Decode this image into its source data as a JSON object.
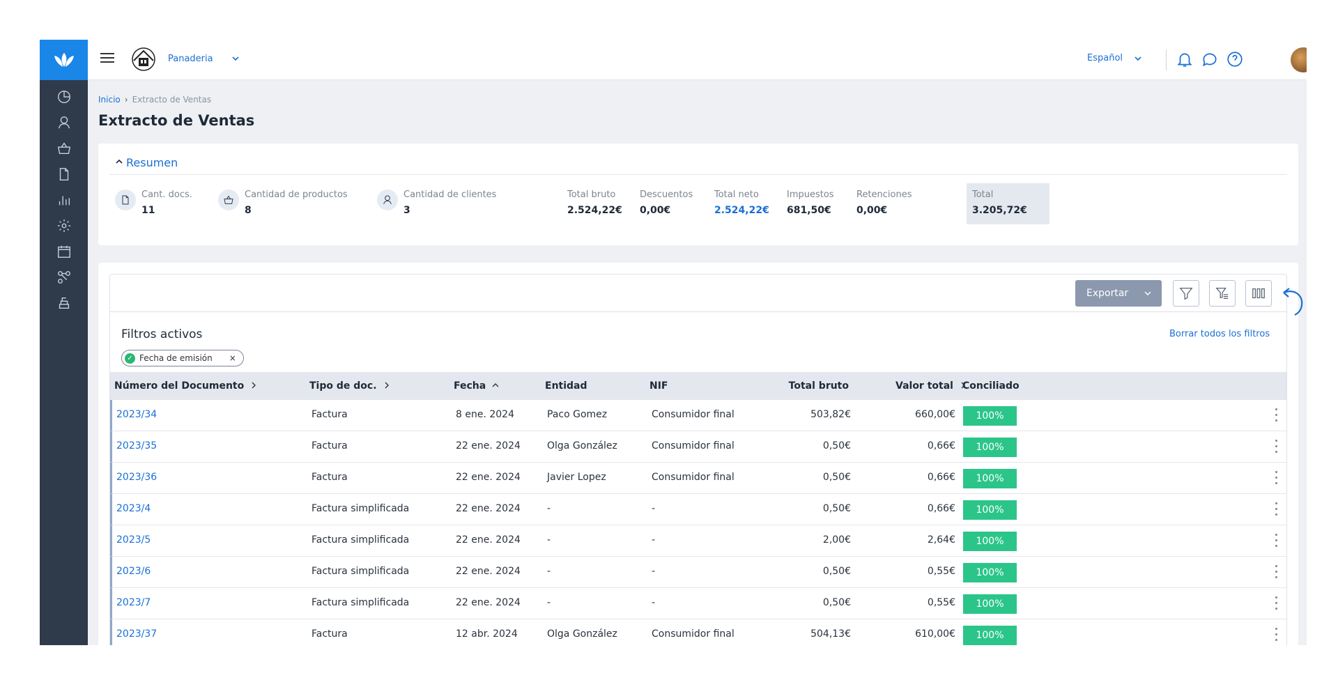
{
  "topbar": {
    "company_name": "Panaderia",
    "language": "Español"
  },
  "breadcrumb": {
    "home": "Inicio",
    "separator": "›",
    "current": "Extracto de Ventas"
  },
  "page": {
    "title": "Extracto de Ventas"
  },
  "summary": {
    "header": "Resumen",
    "stats": [
      {
        "label": "Cant. docs.",
        "value": "11",
        "icon": "document-icon"
      },
      {
        "label": "Cantidad de productos",
        "value": "8",
        "icon": "basket-icon"
      },
      {
        "label": "Cantidad de clientes",
        "value": "3",
        "icon": "user-icon"
      }
    ],
    "totals": [
      {
        "label": "Total bruto",
        "value": "2.524,22€"
      },
      {
        "label": "Descuentos",
        "value": "0,00€"
      },
      {
        "label": "Total neto",
        "value": "2.524,22€",
        "accent": "#1a6fd4"
      },
      {
        "label": "Impuestos",
        "value": "681,50€"
      },
      {
        "label": "Retenciones",
        "value": "0,00€"
      },
      {
        "label": "Total",
        "value": "3.205,72€"
      }
    ]
  },
  "toolbar": {
    "export_label": "Exportar"
  },
  "filters": {
    "title": "Filtros activos",
    "clear_all": "Borrar todos los filtros",
    "active": [
      {
        "label": "Fecha de emisión",
        "remove": "×"
      }
    ]
  },
  "table": {
    "columns": {
      "doc_number": "Número del Documento",
      "doc_type": "Tipo de doc.",
      "date": "Fecha",
      "entity": "Entidad",
      "nif": "NIF",
      "gross": "Total bruto",
      "total": "Valor total",
      "reconciled": "Conciliado"
    },
    "rows": [
      {
        "doc_number": "2023/34",
        "doc_type": "Factura",
        "date": "8 ene. 2024",
        "entity": "Paco Gomez",
        "nif": "Consumidor final",
        "gross": "503,82€",
        "total": "660,00€",
        "reconciled": "100%"
      },
      {
        "doc_number": "2023/35",
        "doc_type": "Factura",
        "date": "22 ene. 2024",
        "entity": "Olga González",
        "nif": "Consumidor final",
        "gross": "0,50€",
        "total": "0,66€",
        "reconciled": "100%"
      },
      {
        "doc_number": "2023/36",
        "doc_type": "Factura",
        "date": "22 ene. 2024",
        "entity": "Javier Lopez",
        "nif": "Consumidor final",
        "gross": "0,50€",
        "total": "0,66€",
        "reconciled": "100%"
      },
      {
        "doc_number": "2023/4",
        "doc_type": "Factura simplificada",
        "date": "22 ene. 2024",
        "entity": "-",
        "nif": "-",
        "gross": "0,50€",
        "total": "0,66€",
        "reconciled": "100%"
      },
      {
        "doc_number": "2023/5",
        "doc_type": "Factura simplificada",
        "date": "22 ene. 2024",
        "entity": "-",
        "nif": "-",
        "gross": "2,00€",
        "total": "2,64€",
        "reconciled": "100%"
      },
      {
        "doc_number": "2023/6",
        "doc_type": "Factura simplificada",
        "date": "22 ene. 2024",
        "entity": "-",
        "nif": "-",
        "gross": "0,50€",
        "total": "0,55€",
        "reconciled": "100%"
      },
      {
        "doc_number": "2023/7",
        "doc_type": "Factura simplificada",
        "date": "22 ene. 2024",
        "entity": "-",
        "nif": "-",
        "gross": "0,50€",
        "total": "0,55€",
        "reconciled": "100%"
      },
      {
        "doc_number": "2023/37",
        "doc_type": "Factura",
        "date": "12 abr. 2024",
        "entity": "Olga González",
        "nif": "Consumidor final",
        "gross": "504,13€",
        "total": "610,00€",
        "reconciled": "100%"
      }
    ]
  },
  "colors": {
    "brand": "#1a86e8",
    "link": "#1a6fd4",
    "rail": "#2f3a4a",
    "badge": "#2bc58a"
  }
}
